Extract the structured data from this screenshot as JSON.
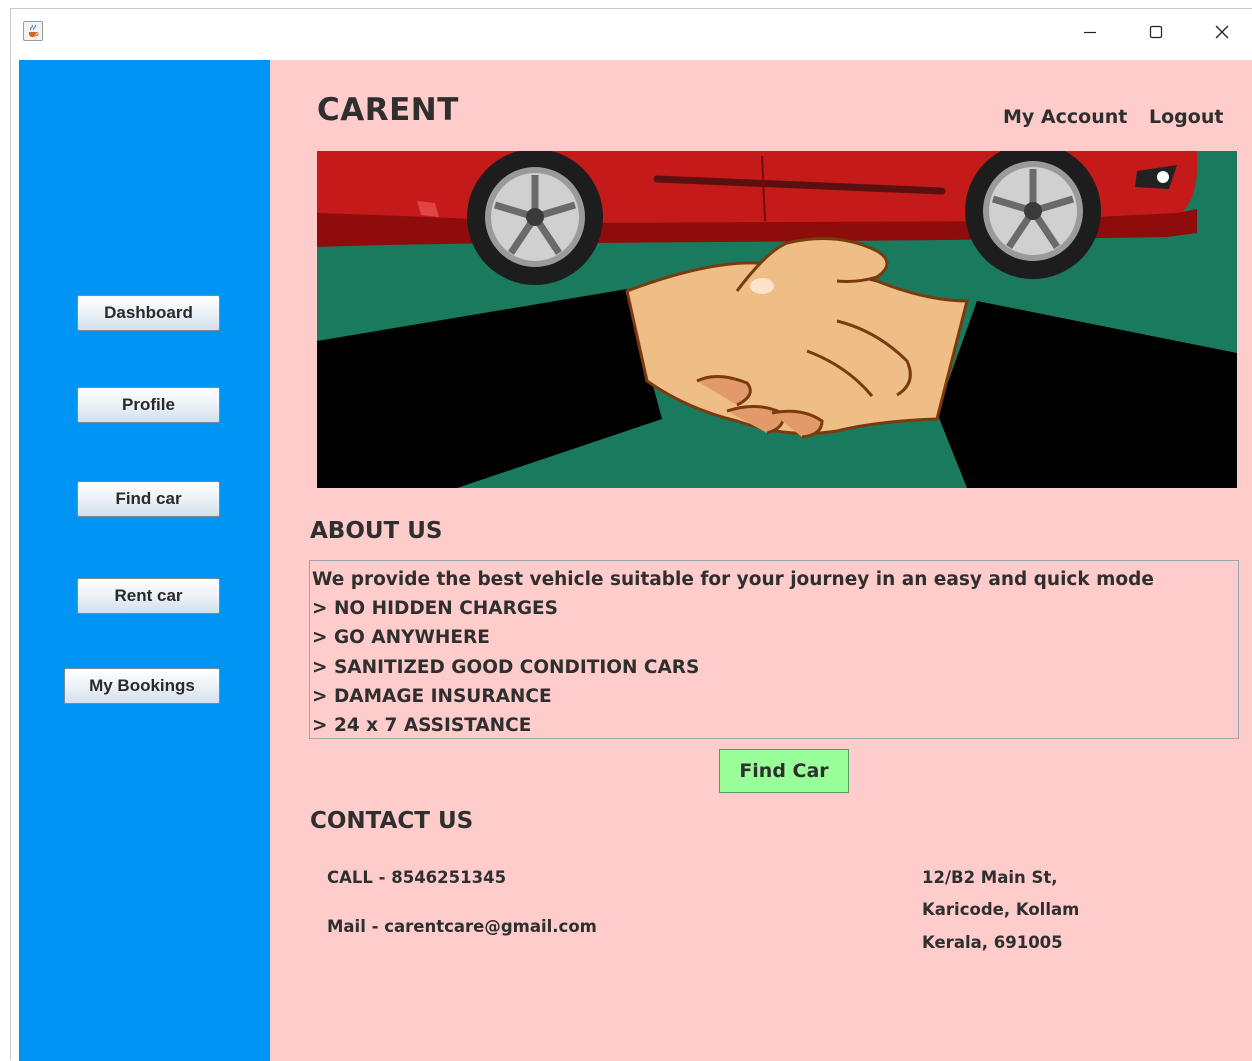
{
  "window": {
    "controls": {
      "minimize": "minimize",
      "maximize": "maximize",
      "close": "close"
    }
  },
  "sidebar": {
    "color": "#0094f4",
    "items": [
      {
        "label": "Dashboard"
      },
      {
        "label": "Profile"
      },
      {
        "label": "Find car"
      },
      {
        "label": "Rent car"
      },
      {
        "label": "My Bookings"
      }
    ]
  },
  "header": {
    "brand": "CARENT",
    "links": {
      "account": "My Account",
      "logout": "Logout"
    }
  },
  "about": {
    "title": "ABOUT US",
    "lines": [
      "We provide the best vehicle suitable for your journey in an easy and quick mode",
      "> NO HIDDEN CHARGES",
      "> GO ANYWHERE",
      "> SANITIZED GOOD CONDITION CARS",
      "> DAMAGE INSURANCE",
      "> 24 x 7 ASSISTANCE"
    ]
  },
  "find_car_button": "Find Car",
  "contact": {
    "title": "CONTACT US",
    "call": "CALL - 8546251345",
    "mail": "Mail - carentcare@gmail.com",
    "address": [
      "12/B2 Main St,",
      "Karicode, Kollam",
      "Kerala, 691005"
    ]
  },
  "colors": {
    "main_background": "#ffcccc",
    "find_button": "#99ff99",
    "text": "#2f2f2f"
  }
}
